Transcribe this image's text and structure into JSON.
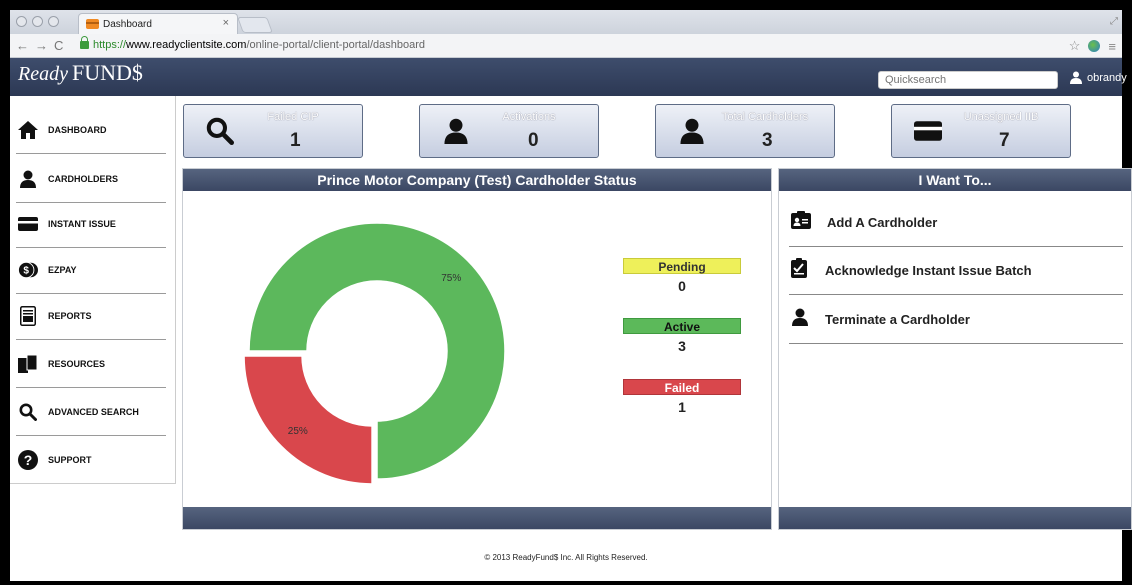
{
  "browser": {
    "tab_title": "Dashboard",
    "tab_close": "×",
    "url_scheme": "https://",
    "url_host": "www.readyclientsite.com",
    "url_path": "/online-portal/client-portal/dashboard"
  },
  "header": {
    "logo_ready": "Ready",
    "logo_funds": "FUND$",
    "quicksearch_placeholder": "Quicksearch",
    "username": "obrandy"
  },
  "sidebar": {
    "items": [
      {
        "label": "DASHBOARD",
        "icon": "home-icon"
      },
      {
        "label": "CARDHOLDERS",
        "icon": "person-icon"
      },
      {
        "label": "INSTANT ISSUE",
        "icon": "card-icon"
      },
      {
        "label": "EZPAY",
        "icon": "money-icon"
      },
      {
        "label": "REPORTS",
        "icon": "report-icon"
      },
      {
        "label": "RESOURCES",
        "icon": "documents-icon"
      },
      {
        "label": "ADVANCED SEARCH",
        "icon": "search-icon"
      },
      {
        "label": "SUPPORT",
        "icon": "question-icon"
      }
    ]
  },
  "stats": [
    {
      "title": "Failed CIP",
      "value": "1",
      "icon": "search-icon"
    },
    {
      "title": "Activations",
      "value": "0",
      "icon": "person-icon"
    },
    {
      "title": "Total Cardholders",
      "value": "3",
      "icon": "person-icon"
    },
    {
      "title": "Unassigned IIB",
      "value": "7",
      "icon": "card-icon"
    }
  ],
  "status_panel": {
    "title": "Prince Motor Company (Test) Cardholder Status",
    "legend": [
      {
        "label": "Pending",
        "value": "0",
        "color": "#eef05a"
      },
      {
        "label": "Active",
        "value": "3",
        "color": "#5cb95a"
      },
      {
        "label": "Failed",
        "value": "1",
        "color": "#d9474c"
      }
    ]
  },
  "chart_data": {
    "type": "pie",
    "donut": true,
    "slices": [
      {
        "label": "Active",
        "value": 75,
        "display": "75%",
        "color": "#5cb85c"
      },
      {
        "label": "Failed",
        "value": 25,
        "display": "25%",
        "color": "#d9474c"
      }
    ]
  },
  "want_panel": {
    "title": "I Want To...",
    "items": [
      {
        "label": "Add A Cardholder",
        "icon": "id-card-icon"
      },
      {
        "label": "Acknowledge Instant Issue Batch",
        "icon": "checklist-icon"
      },
      {
        "label": "Terminate a Cardholder",
        "icon": "person-icon"
      }
    ]
  },
  "footer": {
    "copyright": "© 2013 ReadyFund$ Inc. All Rights Reserved."
  },
  "colors": {
    "header_bg": "#34415e",
    "panel_head": "#46536f",
    "active_green": "#5cb85c",
    "failed_red": "#d9474c",
    "pending_yellow": "#eef05a"
  }
}
